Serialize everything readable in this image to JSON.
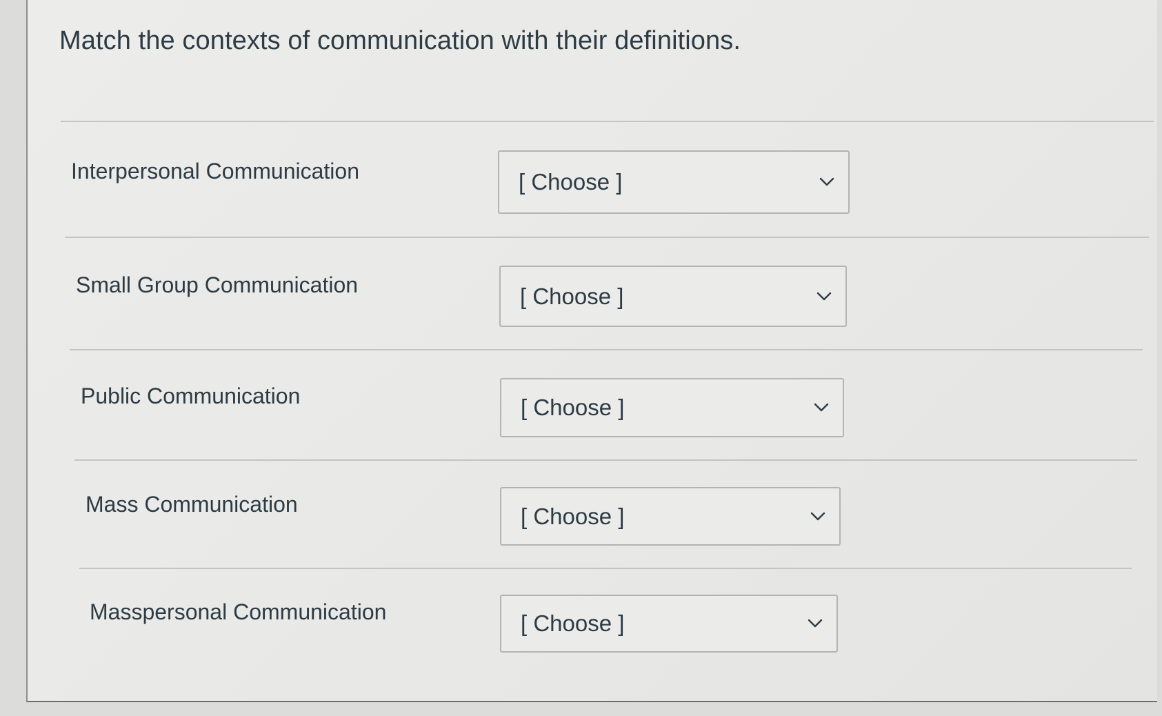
{
  "question": {
    "text": "Match the contexts of communication with their definitions."
  },
  "match_rows": [
    {
      "label": "Interpersonal Communication",
      "selected": "[ Choose ]"
    },
    {
      "label": "Small Group Communication",
      "selected": "[ Choose ]"
    },
    {
      "label": "Public Communication",
      "selected": "[ Choose ]"
    },
    {
      "label": "Mass Communication",
      "selected": "[ Choose ]"
    },
    {
      "label": "Masspersonal Communication",
      "selected": "[ Choose ]"
    }
  ],
  "icons": {
    "dropdown": "chevron-down-icon"
  },
  "colors": {
    "text": "#2d3b45",
    "divider": "#c4c4c2",
    "select_border": "#b4b4b2"
  }
}
